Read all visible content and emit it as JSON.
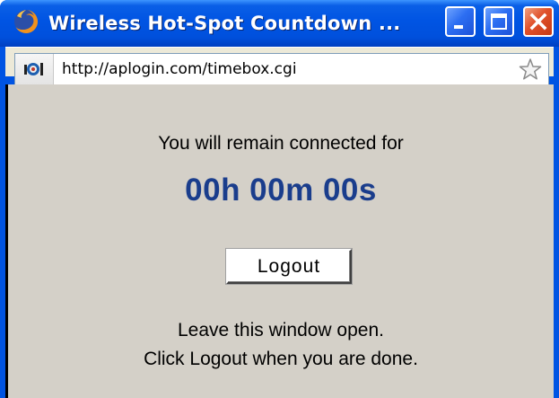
{
  "window": {
    "title": "Wireless Hot-Spot Countdown ...",
    "icon": "firefox-icon",
    "controls": [
      "minimize-icon",
      "maximize-icon",
      "close-icon"
    ]
  },
  "address_bar": {
    "url": "http://aplogin.com/timebox.cgi",
    "site_icon": "site-favicon-icon",
    "bookmark_icon": "star-icon"
  },
  "page": {
    "intro_text": "You will remain connected for",
    "countdown": "00h 00m 00s",
    "logout_label": "Logout",
    "instruction_line1": "Leave this window open.",
    "instruction_line2": "Click Logout when you are done."
  },
  "colors": {
    "titlebar": "#0054e3",
    "content_bg": "#d4d0c8",
    "countdown_text": "#1a3d8c"
  }
}
